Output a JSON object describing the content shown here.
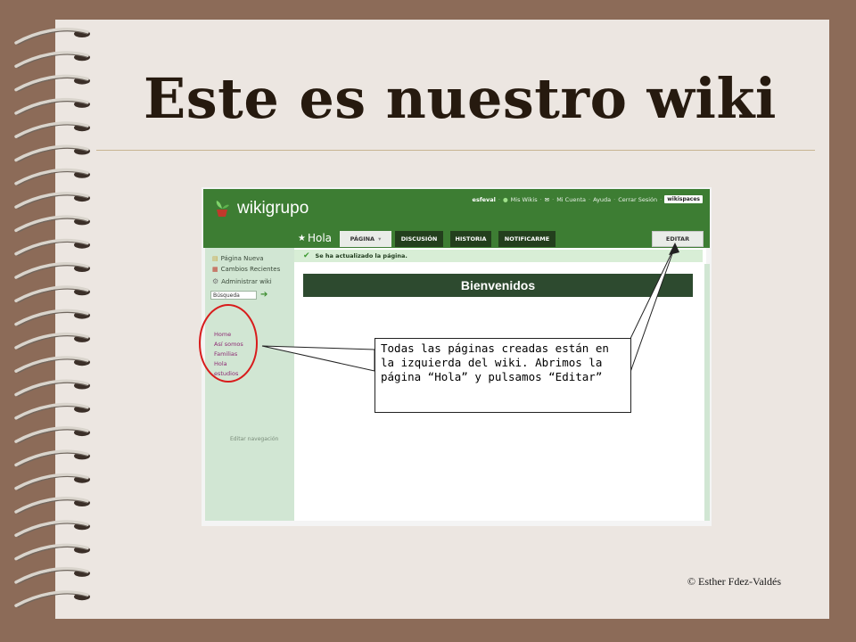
{
  "slide": {
    "title": "Este es nuestro wiki",
    "copyright": "© Esther Fdez-Valdés"
  },
  "wiki": {
    "brand": "wikigrupo",
    "top_links": {
      "user": "esfeval",
      "my_wikis": "Mis Wikis",
      "my_account": "Mi Cuenta",
      "help": "Ayuda",
      "logout": "Cerrar Sesión",
      "wikispaces": "wikispaces"
    },
    "page_name": "Hola",
    "tabs": {
      "page": "PÁGINA",
      "discussion": "DISCUSIÓN",
      "history": "HISTORIA",
      "notify": "NOTIFICARME"
    },
    "edit_button": "EDITAR",
    "sidebar": {
      "new_page": "Página Nueva",
      "recent_changes": "Cambios Recientes",
      "manage_wiki": "Administrar wiki",
      "search_placeholder": "Búsqueda",
      "nav_items": [
        "Home",
        "Así somos",
        "Familias",
        "Hola",
        "estudios"
      ],
      "edit_navigation": "Editar navegación"
    },
    "notice": "Se ha actualizado la página.",
    "welcome": "Bienvenidos"
  },
  "callout": {
    "text": "Todas las páginas creadas están en la izquierda del wiki. Abrimos la página “Hola” y pulsamos “Editar”"
  },
  "colors": {
    "header_green": "#3d7d33",
    "sidebar_green": "#d1e6d3",
    "welcome_bar": "#2d4a2f",
    "circle_red": "#d81c1c",
    "nav_link": "#8d2b73"
  }
}
